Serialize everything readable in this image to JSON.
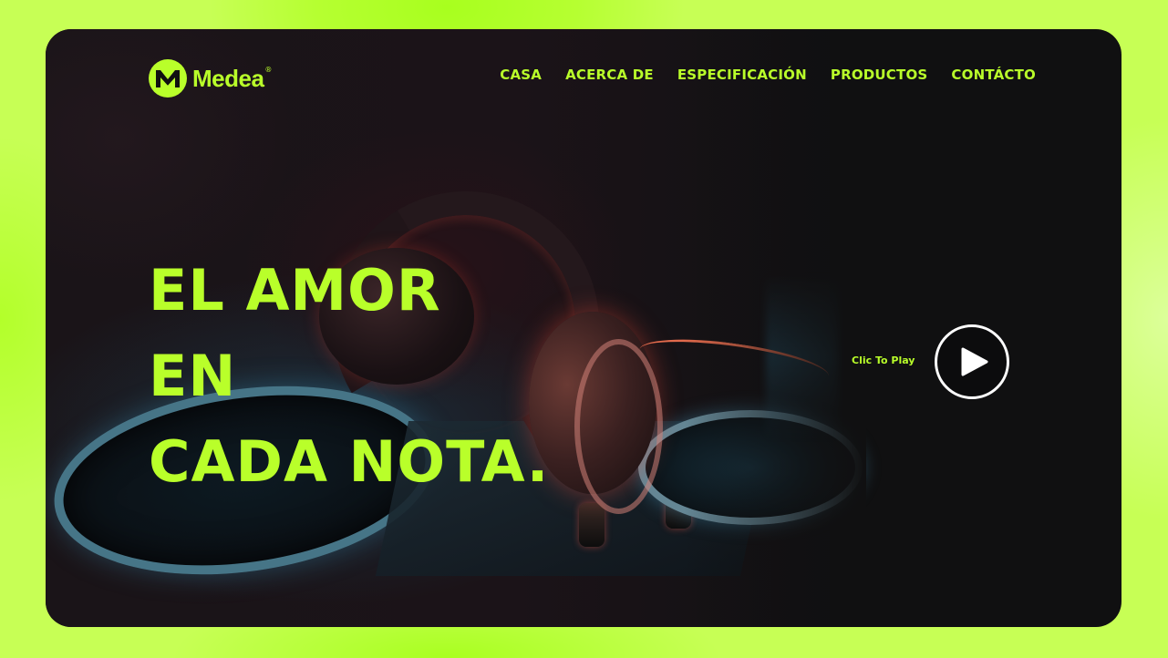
{
  "brand": {
    "name": "Medea",
    "registered_mark": "®",
    "logo_icon": "m-logo-icon"
  },
  "nav": {
    "items": [
      {
        "label": "CASA"
      },
      {
        "label": "ACERCA DE"
      },
      {
        "label": "ESPECIFICACIÓN"
      },
      {
        "label": "PRODUCTOS"
      },
      {
        "label": "CONTÁCTO"
      }
    ]
  },
  "hero": {
    "headline_lines": [
      "EL AMOR",
      "EN",
      "CADA NOTA."
    ],
    "play_label": "Clic To Play",
    "play_icon": "play-icon"
  },
  "colors": {
    "accent": "#b9ff2a",
    "page_background": "#c6ff4d",
    "frame_background": "#101011",
    "play_button_border": "#ffffff"
  }
}
